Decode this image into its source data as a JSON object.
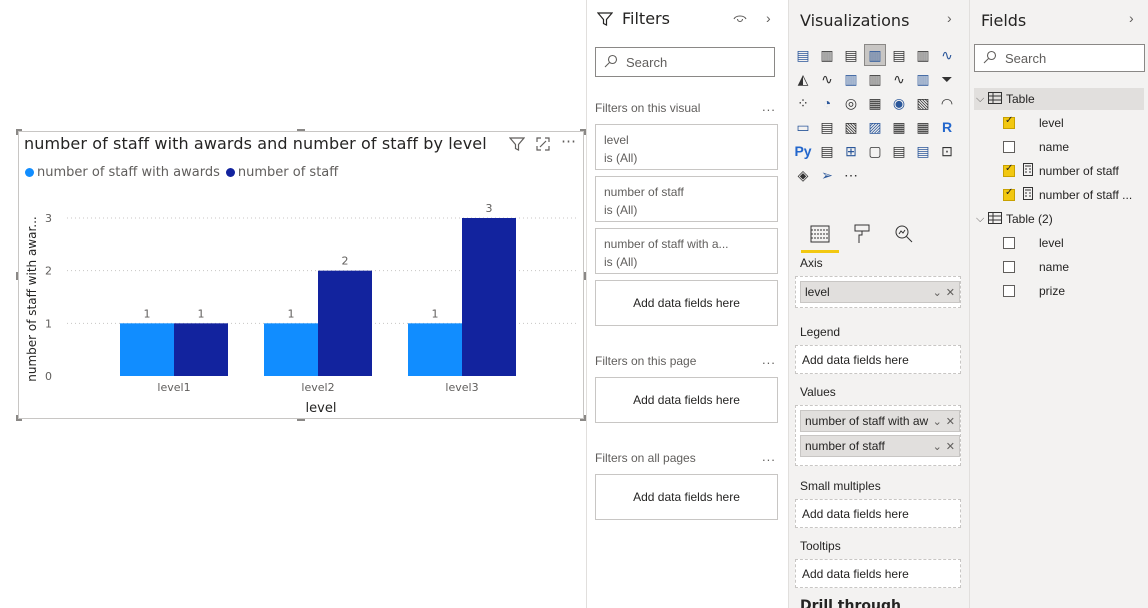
{
  "visual": {
    "title": "number of staff with awards and number of staff by level",
    "legend": [
      {
        "label": "number of staff with awards",
        "color": "#118dff"
      },
      {
        "label": "number of staff",
        "color": "#12239e"
      }
    ],
    "icons": [
      "filter-icon",
      "focus-mode-icon",
      "more-options-icon"
    ]
  },
  "chart_data": {
    "type": "bar",
    "categories": [
      "level1",
      "level2",
      "level3"
    ],
    "series": [
      {
        "name": "number of staff with awards",
        "values": [
          1,
          1,
          1
        ],
        "color": "#118dff"
      },
      {
        "name": "number of staff",
        "values": [
          1,
          2,
          3
        ],
        "color": "#12239e"
      }
    ],
    "xlabel": "level",
    "ylabel": "number of staff with awar...",
    "ylim": [
      0,
      3
    ],
    "yticks": [
      0,
      1,
      2,
      3
    ],
    "grid": true,
    "legend_position": "top-left"
  },
  "filters": {
    "title": "Filters",
    "search_placeholder": "Search",
    "on_visual_label": "Filters on this visual",
    "on_page_label": "Filters on this page",
    "on_all_label": "Filters on all pages",
    "more": "...",
    "cards": [
      {
        "field": "level",
        "state": "is (All)"
      },
      {
        "field": "number of staff",
        "state": "is (All)"
      },
      {
        "field": "number of staff with a...",
        "state": "is (All)"
      }
    ],
    "add_fields": "Add data fields here"
  },
  "viz": {
    "title": "Visualizations",
    "icons": [
      "▤",
      "▥",
      "▤",
      "▥",
      "▤",
      "▥",
      "∿",
      "◭",
      "∿",
      "▥",
      "▥",
      "∿",
      "▥",
      "⏷",
      "⁘",
      "◔",
      "◎",
      "▦",
      "◉",
      "▧",
      "◠",
      "▭",
      "▤",
      "▧",
      "▨",
      "▦",
      "▦",
      "R",
      "Py",
      "▤",
      "⊞",
      "▢",
      "▤",
      "▤",
      "⊡",
      "◈",
      "➢",
      "⋯"
    ],
    "selected_index": 3,
    "axis_label": "Axis",
    "axis_field": "level",
    "legend_label": "Legend",
    "values_label": "Values",
    "values_fields": [
      "number of staff with aw",
      "number of staff"
    ],
    "small_multiples_label": "Small multiples",
    "tooltips_label": "Tooltips",
    "drill_label": "Drill through",
    "add_fields": "Add data fields here"
  },
  "fields": {
    "title": "Fields",
    "search_placeholder": "Search",
    "tables": [
      {
        "name": "Table",
        "highlighted": true,
        "fields": [
          {
            "name": "level",
            "checked": true,
            "measure": false
          },
          {
            "name": "name",
            "checked": false,
            "measure": false
          },
          {
            "name": "number of staff",
            "checked": true,
            "measure": true
          },
          {
            "name": "number of staff ...",
            "checked": true,
            "measure": true
          }
        ]
      },
      {
        "name": "Table (2)",
        "highlighted": false,
        "fields": [
          {
            "name": "level",
            "checked": false,
            "measure": false
          },
          {
            "name": "name",
            "checked": false,
            "measure": false
          },
          {
            "name": "prize",
            "checked": false,
            "measure": false
          }
        ]
      }
    ]
  }
}
